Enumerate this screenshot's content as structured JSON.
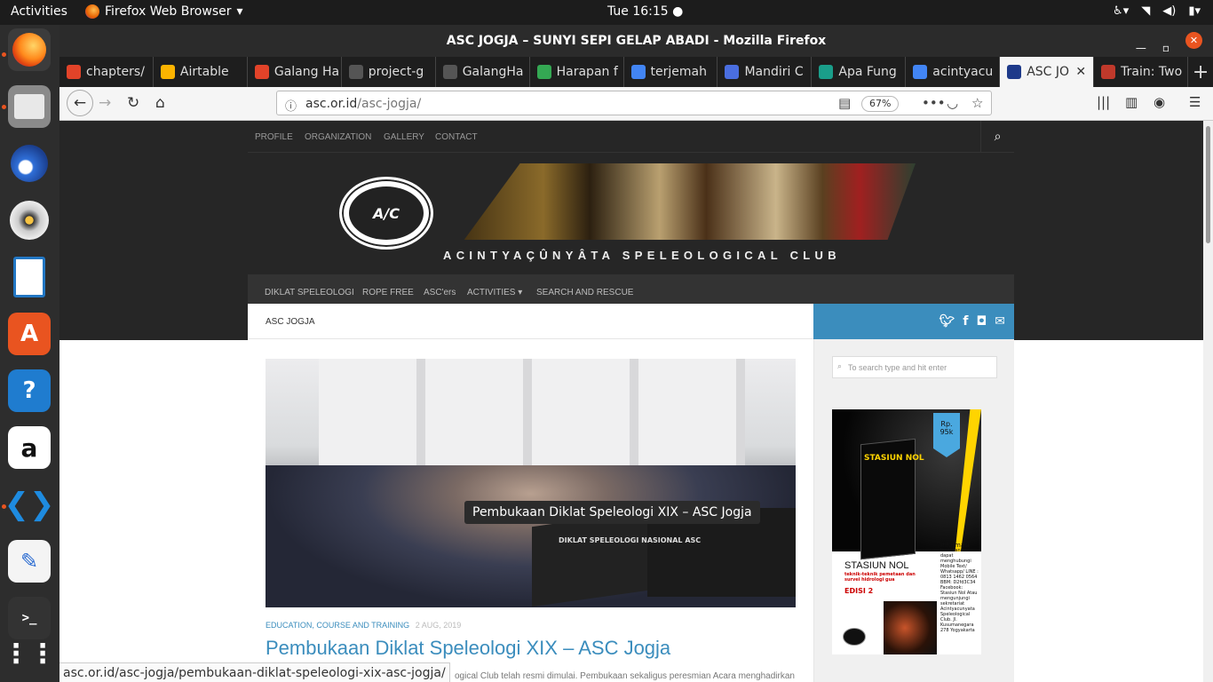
{
  "topbar": {
    "activities": "Activities",
    "app_name": "Firefox Web Browser",
    "clock": "Tue 16:15 ●"
  },
  "dock": {
    "items": [
      "firefox-icon",
      "files-icon",
      "thunderbird-icon",
      "rhythmbox-icon",
      "libreoffice-writer-icon",
      "software-center-icon",
      "help-icon",
      "amazon-icon",
      "vscode-icon",
      "text-editor-icon",
      "terminal-icon",
      "show-apps-icon"
    ]
  },
  "window": {
    "title": "ASC JOGJA – SUNYI SEPI GELAP ABADI - Mozilla Firefox"
  },
  "tabs": [
    {
      "label": "chapters/",
      "color": "#e24329"
    },
    {
      "label": "Airtable",
      "color": "#fcb400"
    },
    {
      "label": "Galang Ha",
      "color": "#e24329"
    },
    {
      "label": "project-g",
      "color": "#555555"
    },
    {
      "label": "GalangHa",
      "color": "#555555"
    },
    {
      "label": "Harapan f",
      "color": "#34a853"
    },
    {
      "label": "terjemah",
      "color": "#4285f4"
    },
    {
      "label": "Mandiri C",
      "color": "#4a6ee0"
    },
    {
      "label": "Apa Fung",
      "color": "#1a9e8a"
    },
    {
      "label": "acintyacu",
      "color": "#4285f4"
    },
    {
      "label": "ASC JO",
      "color": "#1e3a8a"
    },
    {
      "label": "Train: Two",
      "color": "#c0392b"
    }
  ],
  "navbar": {
    "url_host": "asc.or.id",
    "url_path": "/asc-jogja/",
    "zoom": "67%"
  },
  "site": {
    "topnav": [
      "PROFILE",
      "ORGANIZATION",
      "GALLERY",
      "CONTACT"
    ],
    "logo_text": "A/C",
    "name": "ACINTYAÇÛNYÂTA SPELEOLOGICAL CLUB",
    "mainnav": [
      "DIKLAT SPELEOLOGI",
      "ROPE FREE",
      "ASC'ers",
      "ACTIVITIES ▾",
      "SEARCH AND RESCUE"
    ],
    "breadcrumb": "ASC JOGJA",
    "search_placeholder": "To search type and hit enter",
    "post": {
      "category": "EDUCATION, COURSE AND TRAINING",
      "date": "2 AUG, 2019",
      "title": "Pembukaan Diklat Speleologi XIX – ASC Jogja",
      "excerpt": "ogical Club telah resmi dimulai. Pembukaan sekaligus peresmian Acara menghadirkan",
      "image_banner_text": "DIKLAT SPELEOLOGI NASIONAL ASC"
    },
    "tooltip": "Pembukaan Diklat Speleologi XIX – ASC Jogja",
    "ad": {
      "book_title": "STASIUN NOL",
      "price": "Rp. 95k",
      "headline": "STASIUN NOL",
      "subtitle": "teknik-teknik pemetaan dan survei hidrologi gua",
      "edition": "EDISI 2",
      "info_title": "Informasi",
      "info_text": "Pemesanan dapat menghubungi Mobile Text/ Whatsapp/ LINE : 0813 1462 0564 BBM: D2fd3C34 Facebook: Stasiun Nol Atau mengunjungi sekretariat Acintyacunyata Speleological Club. Jl. Kusumanegara 278 Yogyakarta"
    }
  },
  "status_url": "asc.or.id/asc-jogja/pembukaan-diklat-speleologi-xix-asc-jogja/"
}
